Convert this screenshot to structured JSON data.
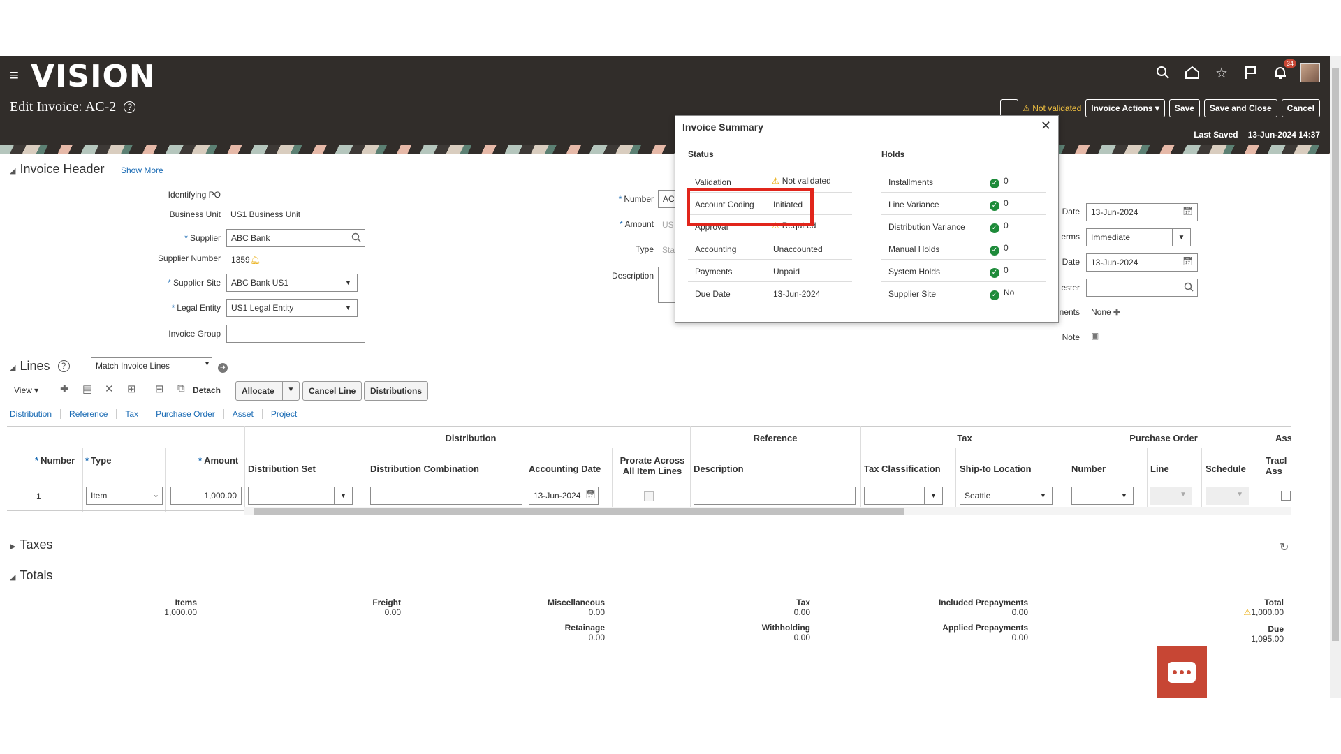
{
  "app": {
    "logo": "VISION",
    "page_title": "Edit Invoice: AC-2",
    "notifications_count": "34",
    "status": "Not validated",
    "actions": {
      "invoice_actions": "Invoice Actions",
      "save": "Save",
      "save_close": "Save and Close",
      "cancel": "Cancel"
    },
    "last_saved_label": "Last Saved",
    "last_saved_value": "13-Jun-2024 14:37"
  },
  "header": {
    "title": "Invoice Header",
    "show_more": "Show More",
    "identifying_po_label": "Identifying PO",
    "business_unit_label": "Business Unit",
    "business_unit_value": "US1 Business Unit",
    "supplier_label": "Supplier",
    "supplier_value": "ABC Bank",
    "supplier_number_label": "Supplier Number",
    "supplier_number_value": "1359",
    "supplier_site_label": "Supplier Site",
    "supplier_site_value": "ABC Bank US1",
    "legal_entity_label": "Legal Entity",
    "legal_entity_value": "US1 Legal Entity",
    "invoice_group_label": "Invoice Group",
    "number_label": "Number",
    "number_value": "AC",
    "amount_label": "Amount",
    "amount_value": "US",
    "type_label": "Type",
    "type_value": "Sta",
    "description_label": "Description",
    "date_label": "Date",
    "date_value": "13-Jun-2024",
    "terms_label": "erms",
    "terms_value": "Immediate",
    "terms_date_label": "Date",
    "terms_date_value": "13-Jun-2024",
    "requester_label": "ester",
    "attachments_label": "nents",
    "attachments_value": "None",
    "note_label": "Note"
  },
  "modal": {
    "title": "Invoice Summary",
    "status_head": "Status",
    "holds_head": "Holds",
    "status_rows": [
      {
        "k": "Validation",
        "v": "Not validated"
      },
      {
        "k": "Account Coding",
        "v": "Initiated"
      },
      {
        "k": "Approval",
        "v": "Required"
      },
      {
        "k": "Accounting",
        "v": "Unaccounted"
      },
      {
        "k": "Payments",
        "v": "Unpaid"
      },
      {
        "k": "Due Date",
        "v": "13-Jun-2024"
      }
    ],
    "hold_rows": [
      {
        "k": "Installments",
        "v": "0"
      },
      {
        "k": "Line Variance",
        "v": "0"
      },
      {
        "k": "Distribution Variance",
        "v": "0"
      },
      {
        "k": "Manual Holds",
        "v": "0"
      },
      {
        "k": "System Holds",
        "v": "0"
      },
      {
        "k": "Supplier Site",
        "v": "No"
      }
    ]
  },
  "lines": {
    "title": "Lines",
    "match_select": "Match Invoice Lines",
    "view": "View",
    "detach": "Detach",
    "allocate": "Allocate",
    "cancel_line": "Cancel Line",
    "distributions": "Distributions",
    "tabs": [
      "Distribution",
      "Reference",
      "Tax",
      "Purchase Order",
      "Asset",
      "Project"
    ],
    "group_heads": [
      "Distribution",
      "Reference",
      "Tax",
      "Purchase Order",
      "Ass"
    ],
    "cols": [
      "Number",
      "Type",
      "Amount",
      "Distribution Set",
      "Distribution Combination",
      "Accounting Date",
      "Prorate Across All Item Lines",
      "Description",
      "Tax Classification",
      "Ship-to Location",
      "Number",
      "Line",
      "Schedule",
      "Tracl Ass"
    ],
    "row": {
      "number": "1",
      "type": "Item",
      "amount": "1,000.00",
      "accounting_date": "13-Jun-2024",
      "ship_to": "Seattle"
    }
  },
  "taxes": {
    "title": "Taxes"
  },
  "totals": {
    "title": "Totals",
    "items": [
      {
        "label": "Items",
        "value": "1,000.00"
      },
      {
        "label": "Freight",
        "value": "0.00"
      },
      {
        "label": "Miscellaneous",
        "value": "0.00"
      },
      {
        "label": "Tax",
        "value": "0.00"
      },
      {
        "label": "Included Prepayments",
        "value": "0.00"
      },
      {
        "label": "Total",
        "value": "1,000.00"
      },
      {
        "label": "Retainage",
        "value": "0.00"
      },
      {
        "label": "Withholding",
        "value": "0.00"
      },
      {
        "label": "Applied Prepayments",
        "value": "0.00"
      },
      {
        "label": "Due",
        "value": "1,095.00"
      }
    ]
  }
}
